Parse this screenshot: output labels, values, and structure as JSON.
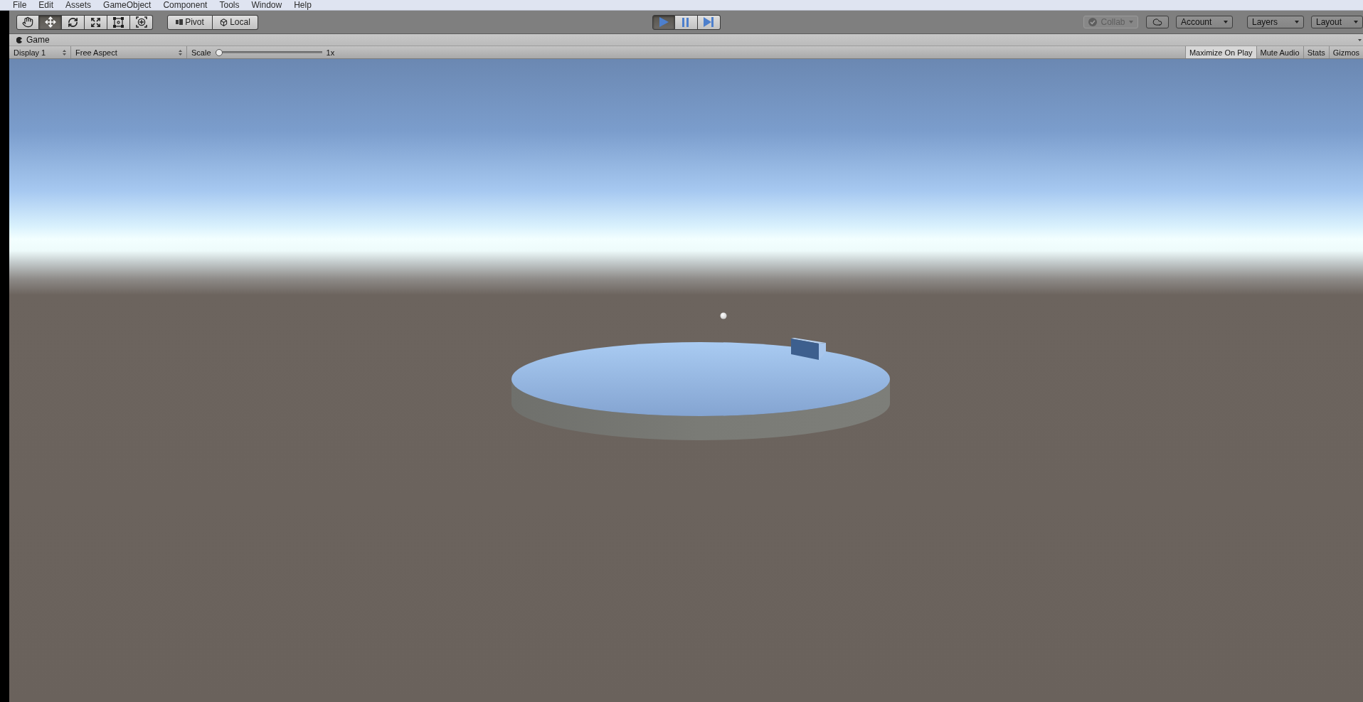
{
  "menu_bar": {
    "items": [
      "File",
      "Edit",
      "Assets",
      "GameObject",
      "Component",
      "Tools",
      "Window",
      "Help"
    ]
  },
  "toolbar": {
    "tools": [
      {
        "kind": "hand",
        "selected": false
      },
      {
        "kind": "move",
        "selected": true
      },
      {
        "kind": "rotate",
        "selected": false
      },
      {
        "kind": "scale",
        "selected": false
      },
      {
        "kind": "rect",
        "selected": false
      },
      {
        "kind": "transform",
        "selected": false
      }
    ],
    "handle_modes": [
      {
        "kind": "pivot",
        "label": "Pivot"
      },
      {
        "kind": "space",
        "label": "Local"
      }
    ],
    "playback": [
      {
        "kind": "play",
        "selected": true
      },
      {
        "kind": "pause",
        "selected": false
      },
      {
        "kind": "step",
        "selected": false
      }
    ],
    "collab": {
      "label": "Collab",
      "disabled": true
    },
    "menus": [
      {
        "label": "Account"
      },
      {
        "label": "Layers"
      },
      {
        "label": "Layout"
      }
    ]
  },
  "game_tab": {
    "label": "Game"
  },
  "game_toolbar": {
    "display": "Display 1",
    "aspect": "Free Aspect",
    "scale": {
      "label": "Scale",
      "level": 0,
      "reading": "1x"
    },
    "toggles": [
      {
        "label": "Maximize On Play",
        "on": true
      },
      {
        "label": "Mute Audio",
        "on": false
      },
      {
        "label": "Stats",
        "on": false
      },
      {
        "label": "Gizmos",
        "on": false
      }
    ]
  }
}
